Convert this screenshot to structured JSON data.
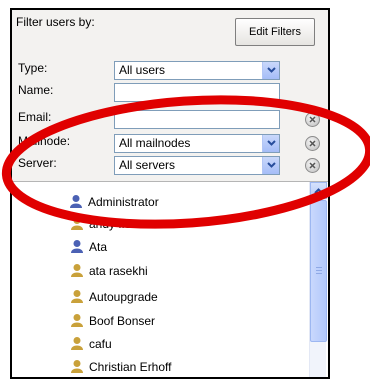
{
  "filter": {
    "title": "Filter users by:",
    "edit_button": "Edit Filters",
    "labels": {
      "type": "Type:",
      "name": "Name:",
      "email": "Email:",
      "mailnode": "Mailnode:",
      "server": "Server:"
    },
    "type_value": "All users",
    "name_value": "",
    "email_value": "",
    "mailnode_value": "All mailnodes",
    "server_value": "All servers"
  },
  "users": [
    {
      "name": "Administrator",
      "icon": "admin-user-icon"
    },
    {
      "name": "andy flower",
      "icon": "user-icon"
    },
    {
      "name": "Ata",
      "icon": "admin-user-icon"
    },
    {
      "name": "ata rasekhi",
      "icon": "user-icon"
    },
    {
      "name": "Autoupgrade",
      "icon": "user-icon"
    },
    {
      "name": "Boof Bonser",
      "icon": "user-icon"
    },
    {
      "name": "cafu",
      "icon": "user-icon"
    },
    {
      "name": "Christian Erhoff",
      "icon": "user-icon"
    }
  ],
  "colors": {
    "annotation_ellipse": "#e00000",
    "admin_icon": "#4b61b4",
    "user_icon": "#c9a13a"
  }
}
